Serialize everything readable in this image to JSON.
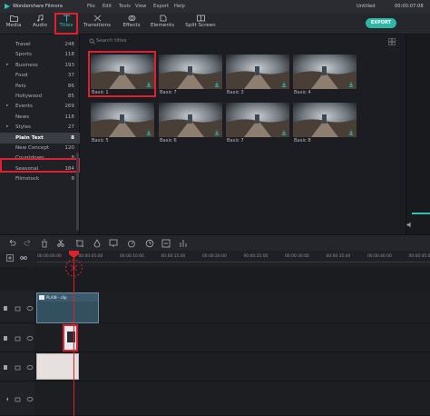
{
  "titlebar": {
    "app_name": "Wondershare Filmora",
    "menus": [
      "File",
      "Edit",
      "Tools",
      "View",
      "Export",
      "Help"
    ],
    "document": "Untitled",
    "timecode": "00:00:07:08"
  },
  "toolbar": {
    "tools": [
      {
        "label": "Media",
        "icon": "folder-icon"
      },
      {
        "label": "Audio",
        "icon": "music-note-icon"
      },
      {
        "label": "Titles",
        "icon": "text-t-icon"
      },
      {
        "label": "Transitions",
        "icon": "transition-icon"
      },
      {
        "label": "Effects",
        "icon": "effects-icon"
      },
      {
        "label": "Elements",
        "icon": "elements-icon"
      },
      {
        "label": "Split Screen",
        "icon": "split-screen-icon"
      }
    ],
    "export_label": "EXPORT",
    "accent": "#2ec3b4"
  },
  "sidebar": {
    "categories": [
      {
        "label": "Travel",
        "count": "248",
        "arrow": false
      },
      {
        "label": "Sports",
        "count": "118",
        "arrow": false
      },
      {
        "label": "Business",
        "count": "193",
        "arrow": true
      },
      {
        "label": "Food",
        "count": "37",
        "arrow": false
      },
      {
        "label": "Pets",
        "count": "86",
        "arrow": false
      },
      {
        "label": "Hollywood",
        "count": "85",
        "arrow": false
      },
      {
        "label": "Events",
        "count": "269",
        "arrow": true
      },
      {
        "label": "News",
        "count": "118",
        "arrow": false
      },
      {
        "label": "Styles",
        "count": "27",
        "arrow": true
      },
      {
        "label": "Plain Text",
        "count": "8",
        "arrow": false,
        "selected": true
      },
      {
        "label": "New Concept",
        "count": "120",
        "arrow": false
      },
      {
        "label": "Countdown",
        "count": "8",
        "arrow": false
      },
      {
        "label": "Seasonal",
        "count": "184",
        "arrow": false
      },
      {
        "label": "Filmstock",
        "count": "8",
        "arrow": false
      }
    ]
  },
  "browser": {
    "search_placeholder": "Search titles",
    "thumbnails": [
      "Basic 1",
      "Basic 7",
      "Basic 3",
      "Basic 4",
      "Basic 5",
      "Basic 6",
      "Basic 7",
      "Basic 8"
    ]
  },
  "timeline": {
    "ruler_labels": [
      "00:00:00:00",
      "00:00:05:00",
      "00:00:10:00",
      "00:00:15:00",
      "00:00:20:00",
      "00:00:25:00",
      "00:00:30:00",
      "00:00:35:00",
      "00:00:40:00",
      "00:00:45:00"
    ],
    "video_clip_label": "PLAIN - clip",
    "selection_color": "#e0202c"
  }
}
